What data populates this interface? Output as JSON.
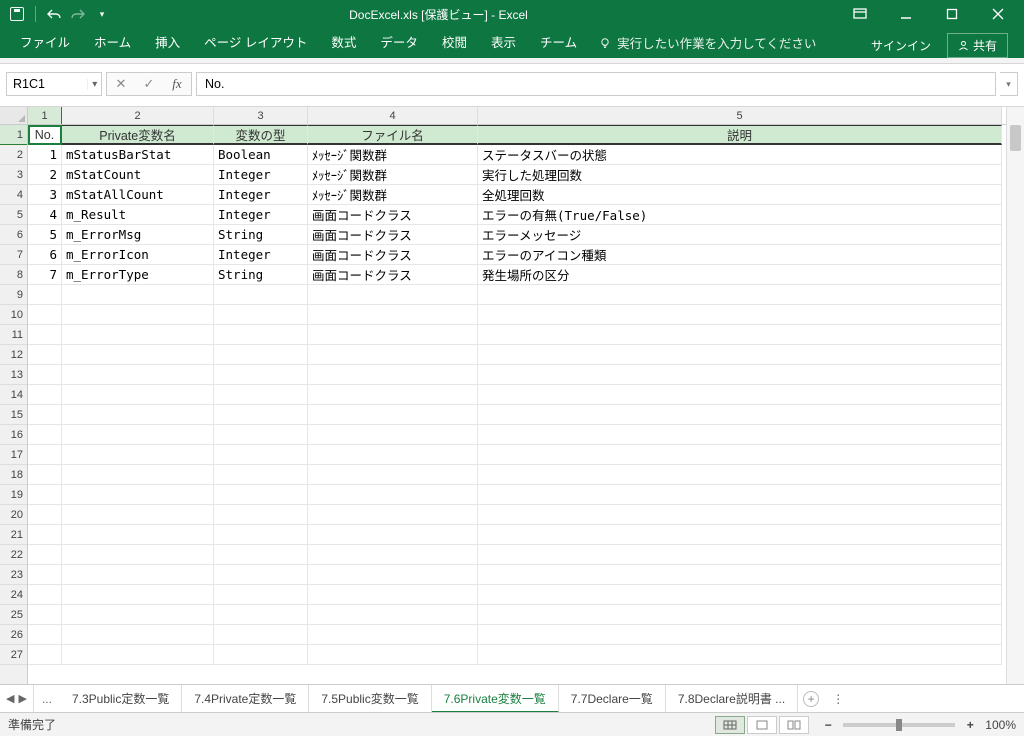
{
  "title": "DocExcel.xls  [保護ビュー] - Excel",
  "ribbon": {
    "tabs": [
      "ファイル",
      "ホーム",
      "挿入",
      "ページ レイアウト",
      "数式",
      "データ",
      "校閲",
      "表示",
      "チーム"
    ],
    "tellme": "実行したい作業を入力してください",
    "signin": "サインイン",
    "share": "共有"
  },
  "namebox": "R1C1",
  "formula": "No.",
  "columns": {
    "1": "1",
    "2": "2",
    "3": "3",
    "4": "4",
    "5": "5"
  },
  "headers": {
    "no": "No.",
    "name": "Private変数名",
    "type": "変数の型",
    "file": "ファイル名",
    "desc": "説明"
  },
  "rows": [
    {
      "no": "1",
      "name": "mStatusBarStat",
      "type": "Boolean",
      "file": "ﾒｯｾｰｼﾞ関数群",
      "desc": "ステータスバーの状態"
    },
    {
      "no": "2",
      "name": "mStatCount",
      "type": "Integer",
      "file": "ﾒｯｾｰｼﾞ関数群",
      "desc": "実行した処理回数"
    },
    {
      "no": "3",
      "name": "mStatAllCount",
      "type": "Integer",
      "file": "ﾒｯｾｰｼﾞ関数群",
      "desc": "全処理回数"
    },
    {
      "no": "4",
      "name": "m_Result",
      "type": "Integer",
      "file": "画面コードクラス",
      "desc": "エラーの有無(True/False)"
    },
    {
      "no": "5",
      "name": "m_ErrorMsg",
      "type": "String",
      "file": "画面コードクラス",
      "desc": "エラーメッセージ"
    },
    {
      "no": "6",
      "name": "m_ErrorIcon",
      "type": "Integer",
      "file": "画面コードクラス",
      "desc": "エラーのアイコン種類"
    },
    {
      "no": "7",
      "name": "m_ErrorType",
      "type": "String",
      "file": "画面コードクラス",
      "desc": "発生場所の区分"
    }
  ],
  "sheets": [
    "7.3Public定数一覧",
    "7.4Private定数一覧",
    "7.5Public変数一覧",
    "7.6Private変数一覧",
    "7.7Declare一覧",
    "7.8Declare説明書 ..."
  ],
  "active_sheet": 3,
  "status": "準備完了",
  "zoom": "100%"
}
